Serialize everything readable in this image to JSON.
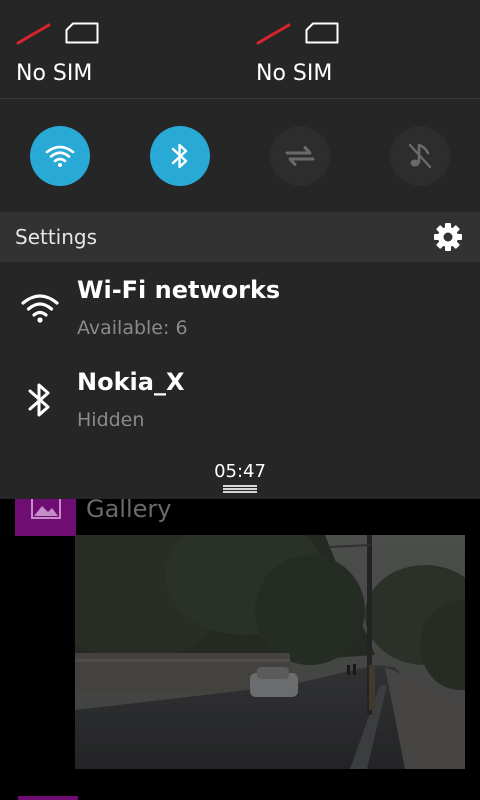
{
  "sims": [
    {
      "label": "No SIM"
    },
    {
      "label": "No SIM"
    }
  ],
  "toggles": [
    {
      "name": "wifi",
      "state": "on"
    },
    {
      "name": "bluetooth",
      "state": "on"
    },
    {
      "name": "mobile-data",
      "state": "off"
    },
    {
      "name": "sound",
      "state": "off"
    }
  ],
  "settings": {
    "title": "Settings"
  },
  "items": {
    "wifi": {
      "primary": "Wi-Fi networks",
      "secondary": "Available: 6"
    },
    "bluetooth": {
      "primary": "Nokia_X",
      "secondary": "Hidden"
    }
  },
  "clock": "05:47",
  "app": {
    "label": "Gallery"
  },
  "colors": {
    "accent": "#29a9d5",
    "tile": "#6f0d73",
    "sim_slash": "#d9242b"
  }
}
